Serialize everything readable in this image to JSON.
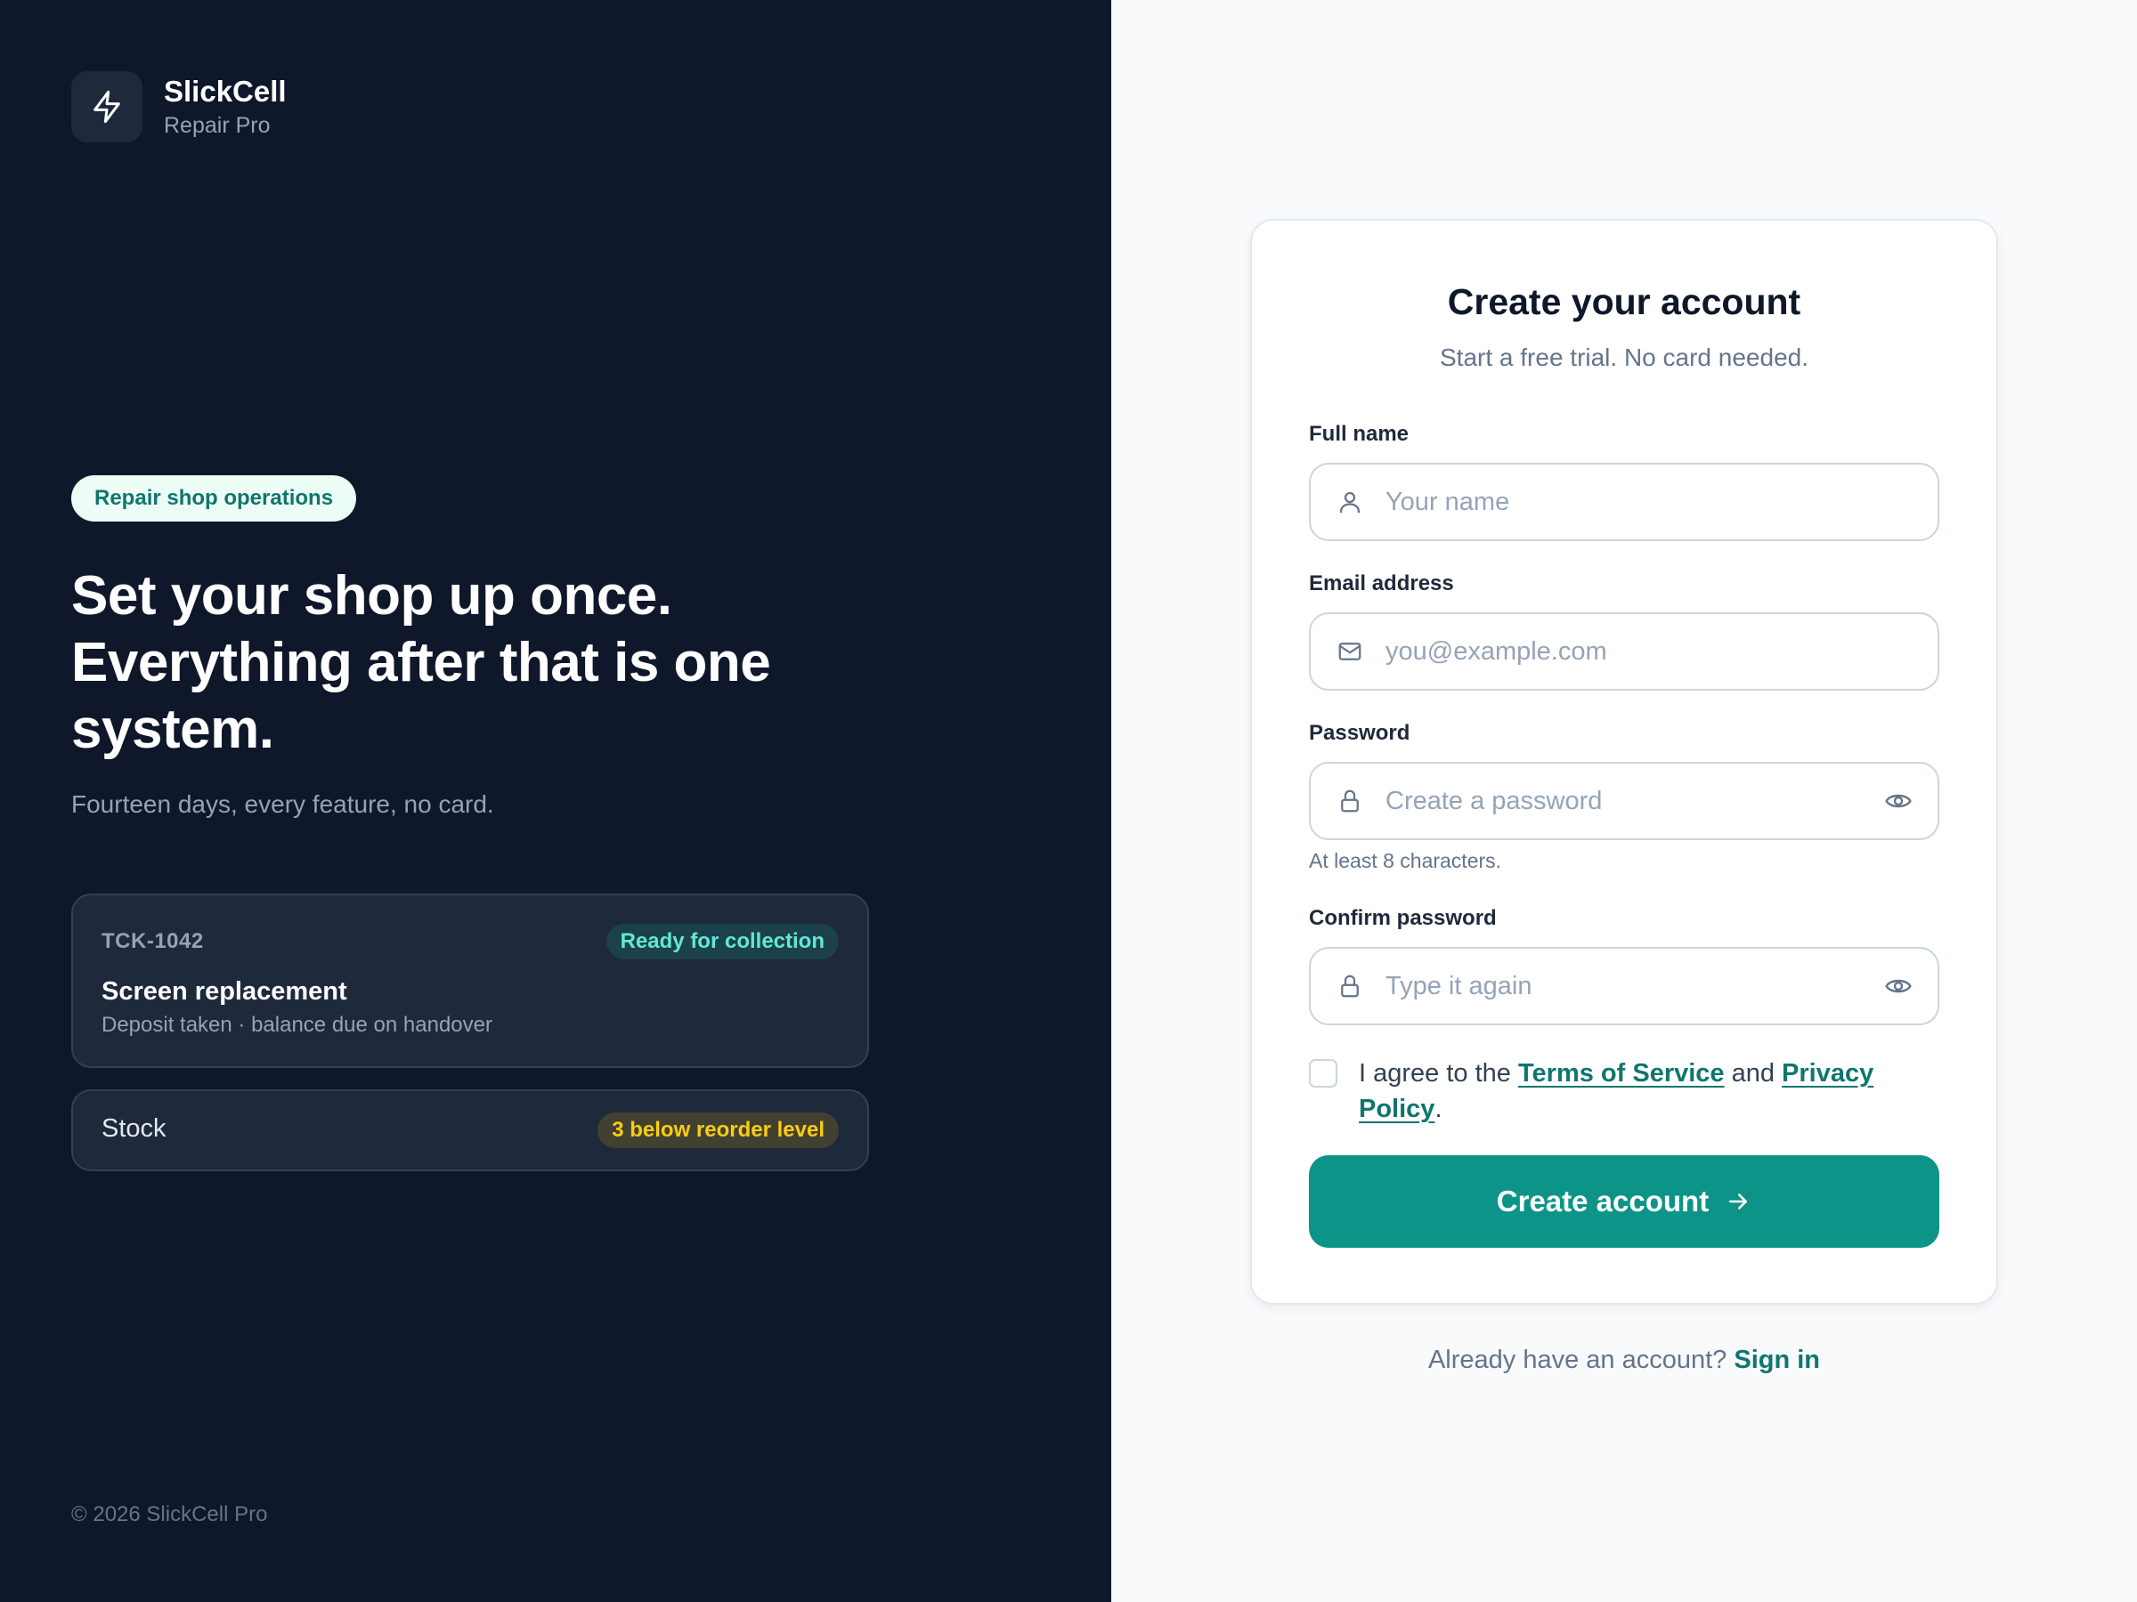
{
  "brand": {
    "name": "SlickCell",
    "subtitle": "Repair Pro",
    "logo_icon": "lightning-bolt-icon"
  },
  "hero": {
    "pill": "Repair shop operations",
    "headline": "Set your shop up once. Everything after that is one system.",
    "subhead": "Fourteen days, every feature, no card."
  },
  "ticket_card": {
    "id": "TCK-1042",
    "status": "Ready for collection",
    "title": "Screen replacement",
    "description": "Deposit taken · balance due on handover"
  },
  "stock_card": {
    "label": "Stock",
    "badge": "3 below reorder level"
  },
  "footer": {
    "copyright": "© 2026 SlickCell Pro"
  },
  "form": {
    "title": "Create your account",
    "subtitle": "Start a free trial. No card needed.",
    "full_name": {
      "label": "Full name",
      "placeholder": "Your name",
      "value": "",
      "icon": "user-icon"
    },
    "email": {
      "label": "Email address",
      "placeholder": "you@example.com",
      "value": "",
      "icon": "mail-icon"
    },
    "password": {
      "label": "Password",
      "placeholder": "Create a password",
      "value": "",
      "hint": "At least 8 characters.",
      "icon": "lock-icon"
    },
    "confirm_password": {
      "label": "Confirm password",
      "placeholder": "Type it again",
      "value": "",
      "icon": "lock-icon"
    },
    "agree": {
      "prefix": "I agree to the ",
      "terms": "Terms of Service",
      "middle": " and ",
      "privacy": "Privacy Policy",
      "suffix": ".",
      "checked": false
    },
    "submit_label": "Create account"
  },
  "signin": {
    "prompt": "Already have an account? ",
    "link": "Sign in"
  },
  "colors": {
    "left_bg": "#0f172a",
    "card_bg": "#1e293b",
    "accent": "#0d9488",
    "accent_text": "#0f766e",
    "ready_badge_text": "#5eead4",
    "warn_badge_text": "#facc15"
  }
}
